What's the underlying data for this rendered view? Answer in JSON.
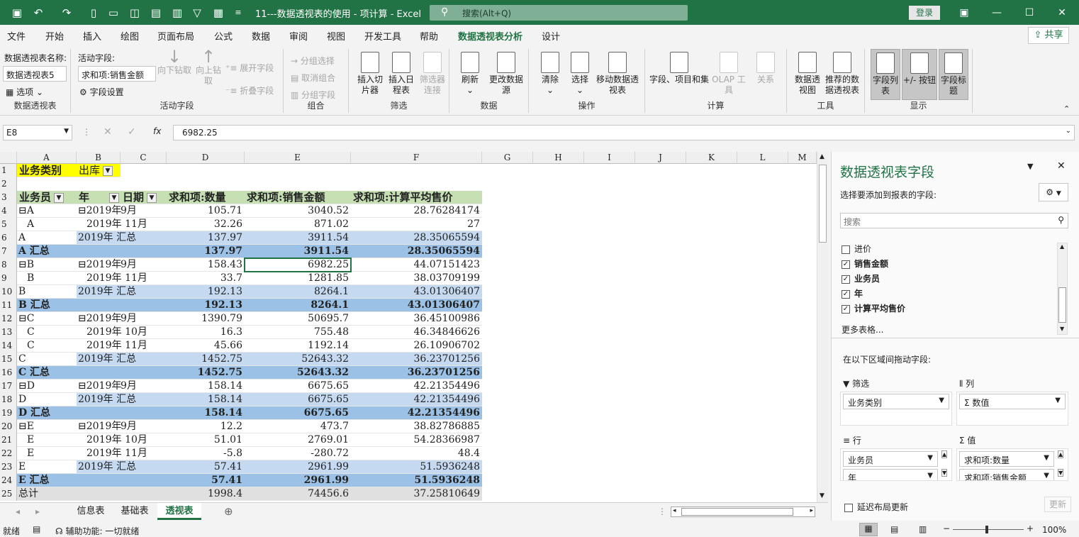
{
  "title_bar": {
    "doc_title": "11---数据透视表的使用 - 项计算 - Excel",
    "search_placeholder": "搜索(Alt+Q)",
    "login": "登录"
  },
  "menu": [
    "文件",
    "开始",
    "插入",
    "绘图",
    "页面布局",
    "公式",
    "数据",
    "审阅",
    "视图",
    "开发工具",
    "帮助",
    "数据透视表分析",
    "设计"
  ],
  "share": "共享",
  "ribbon": {
    "pivot_name_label": "数据透视表名称:",
    "pivot_name": "数据透视表5",
    "options": "选项",
    "group_pivot": "数据透视表",
    "active_field_label": "活动字段:",
    "active_field": "求和项:销售金额",
    "field_settings": "字段设置",
    "drill_down": "向下钻取",
    "drill_up": "向上钻取",
    "expand_field": "展开字段",
    "collapse_field": "折叠字段",
    "group_active": "活动字段",
    "group_selection": "分组选择",
    "ungroup": "取消组合",
    "group_field": "分组字段",
    "group_group": "组合",
    "insert_slicer": "插入切片器",
    "insert_timeline": "插入日程表",
    "filter_connections": "筛选器连接",
    "group_filter": "筛选",
    "refresh": "刷新",
    "change_source": "更改数据源",
    "group_data": "数据",
    "clear": "清除",
    "select": "选择",
    "move_pivot": "移动数据透视表",
    "group_actions": "操作",
    "fields_items": "字段、项目和集",
    "olap": "OLAP 工具",
    "relationships": "关系",
    "group_calc": "计算",
    "pivot_chart": "数据透视图",
    "recommended": "推荐的数据透视表",
    "group_tools": "工具",
    "field_list": "字段列表",
    "buttons": "+/- 按钮",
    "field_headers": "字段标题",
    "group_show": "显示"
  },
  "formula": {
    "name_box": "E8",
    "value": "6982.25"
  },
  "columns": [
    "A",
    "B",
    "C",
    "D",
    "E",
    "F",
    "G",
    "H",
    "I",
    "J",
    "K",
    "L",
    "M"
  ],
  "sheet": {
    "r1": {
      "a": "业务类别",
      "b": "出库"
    },
    "headers": {
      "a": "业务员",
      "b": "年",
      "c": "日期",
      "d": "求和项:数量",
      "e": "求和项:销售金额",
      "f": "求和项:计算平均售价"
    },
    "rows": [
      {
        "n": "4",
        "a": "⊟A",
        "b": "⊟2019年",
        "c": "9月",
        "d": "105.71",
        "e": "3040.52",
        "f": "28.76284174",
        "t": ""
      },
      {
        "n": "5",
        "a": "A",
        "b": "",
        "c": "2019年 11月",
        "d": "32.26",
        "e": "871.02",
        "f": "27",
        "t": "sub"
      },
      {
        "n": "6",
        "a": "A",
        "b": "2019年 汇总",
        "c": "",
        "d": "137.97",
        "e": "3911.54",
        "f": "28.35065594",
        "t": "lt"
      },
      {
        "n": "7",
        "a": "A 汇总",
        "b": "",
        "c": "",
        "d": "137.97",
        "e": "3911.54",
        "f": "28.35065594",
        "t": "bd"
      },
      {
        "n": "8",
        "a": "⊟B",
        "b": "⊟2019年",
        "c": "9月",
        "d": "158.43",
        "e": "6982.25",
        "f": "44.07151423",
        "t": ""
      },
      {
        "n": "9",
        "a": "B",
        "b": "",
        "c": "2019年 11月",
        "d": "33.7",
        "e": "1281.85",
        "f": "38.03709199",
        "t": "sub"
      },
      {
        "n": "10",
        "a": "B",
        "b": "2019年 汇总",
        "c": "",
        "d": "192.13",
        "e": "8264.1",
        "f": "43.01306407",
        "t": "lt"
      },
      {
        "n": "11",
        "a": "B 汇总",
        "b": "",
        "c": "",
        "d": "192.13",
        "e": "8264.1",
        "f": "43.01306407",
        "t": "bd"
      },
      {
        "n": "12",
        "a": "⊟C",
        "b": "⊟2019年",
        "c": "9月",
        "d": "1390.79",
        "e": "50695.7",
        "f": "36.45100986",
        "t": ""
      },
      {
        "n": "13",
        "a": "C",
        "b": "",
        "c": "2019年 10月",
        "d": "16.3",
        "e": "755.48",
        "f": "46.34846626",
        "t": "sub"
      },
      {
        "n": "14",
        "a": "C",
        "b": "",
        "c": "2019年 11月",
        "d": "45.66",
        "e": "1192.14",
        "f": "26.10906702",
        "t": "sub"
      },
      {
        "n": "15",
        "a": "C",
        "b": "2019年 汇总",
        "c": "",
        "d": "1452.75",
        "e": "52643.32",
        "f": "36.23701256",
        "t": "lt"
      },
      {
        "n": "16",
        "a": "C 汇总",
        "b": "",
        "c": "",
        "d": "1452.75",
        "e": "52643.32",
        "f": "36.23701256",
        "t": "bd"
      },
      {
        "n": "17",
        "a": "⊟D",
        "b": "⊟2019年",
        "c": "9月",
        "d": "158.14",
        "e": "6675.65",
        "f": "42.21354496",
        "t": ""
      },
      {
        "n": "18",
        "a": "D",
        "b": "2019年 汇总",
        "c": "",
        "d": "158.14",
        "e": "6675.65",
        "f": "42.21354496",
        "t": "lt"
      },
      {
        "n": "19",
        "a": "D 汇总",
        "b": "",
        "c": "",
        "d": "158.14",
        "e": "6675.65",
        "f": "42.21354496",
        "t": "bd"
      },
      {
        "n": "20",
        "a": "⊟E",
        "b": "⊟2019年",
        "c": "9月",
        "d": "12.2",
        "e": "473.7",
        "f": "38.82786885",
        "t": ""
      },
      {
        "n": "21",
        "a": "E",
        "b": "",
        "c": "2019年 10月",
        "d": "51.01",
        "e": "2769.01",
        "f": "54.28366987",
        "t": "sub"
      },
      {
        "n": "22",
        "a": "E",
        "b": "",
        "c": "2019年 11月",
        "d": "-5.8",
        "e": "-280.72",
        "f": "48.4",
        "t": "sub"
      },
      {
        "n": "23",
        "a": "E",
        "b": "2019年 汇总",
        "c": "",
        "d": "57.41",
        "e": "2961.99",
        "f": "51.5936248",
        "t": "lt"
      },
      {
        "n": "24",
        "a": "E 汇总",
        "b": "",
        "c": "",
        "d": "57.41",
        "e": "2961.99",
        "f": "51.5936248",
        "t": "bd"
      },
      {
        "n": "25",
        "a": "总计",
        "b": "",
        "c": "",
        "d": "1998.4",
        "e": "74456.6",
        "f": "37.25810649",
        "t": "tot"
      }
    ]
  },
  "tabs": [
    "信息表",
    "基础表",
    "透视表"
  ],
  "status": {
    "ready": "就绪",
    "accessibility": "辅助功能: 一切就绪",
    "zoom": "100%"
  },
  "pane": {
    "title": "数据透视表字段",
    "subtitle": "选择要添加到报表的字段:",
    "search_placeholder": "搜索",
    "fields": [
      {
        "name": "进价",
        "checked": false
      },
      {
        "name": "销售金额",
        "checked": true
      },
      {
        "name": "业务员",
        "checked": true
      },
      {
        "name": "年",
        "checked": true
      },
      {
        "name": "计算平均售价",
        "checked": true
      }
    ],
    "more_tables": "更多表格...",
    "drag_hint": "在以下区域间拖动字段:",
    "filter_label": "筛选",
    "columns_label": "列",
    "rows_label": "行",
    "values_label": "值",
    "filter_items": [
      "业务类别"
    ],
    "column_items": [
      "Σ 数值"
    ],
    "row_items": [
      "业务员",
      "年"
    ],
    "value_items": [
      "求和项:数量",
      "求和项:销售金额"
    ],
    "defer": "延迟布局更新",
    "update": "更新"
  }
}
